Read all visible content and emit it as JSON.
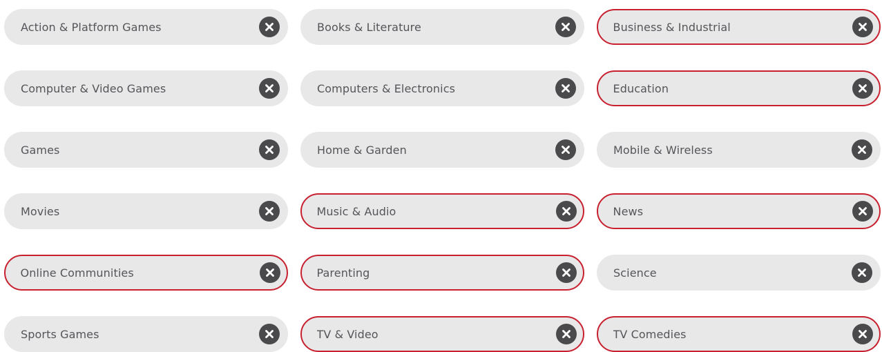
{
  "colors": {
    "chip_background": "#e8e8e9",
    "selected_border": "#c8202e",
    "label_text": "#555559",
    "remove_button": "#4a4a4d"
  },
  "remove_icon": "close-icon",
  "categories": [
    {
      "label": "Action & Platform Games",
      "selected": false
    },
    {
      "label": "Books & Literature",
      "selected": false
    },
    {
      "label": "Business & Industrial",
      "selected": true
    },
    {
      "label": "Computer & Video Games",
      "selected": false
    },
    {
      "label": "Computers & Electronics",
      "selected": false
    },
    {
      "label": "Education",
      "selected": true
    },
    {
      "label": "Games",
      "selected": false
    },
    {
      "label": "Home & Garden",
      "selected": false
    },
    {
      "label": "Mobile & Wireless",
      "selected": false
    },
    {
      "label": "Movies",
      "selected": false
    },
    {
      "label": "Music & Audio",
      "selected": true
    },
    {
      "label": "News",
      "selected": true
    },
    {
      "label": "Online Communities",
      "selected": true
    },
    {
      "label": "Parenting",
      "selected": true
    },
    {
      "label": "Science",
      "selected": false
    },
    {
      "label": "Sports Games",
      "selected": false
    },
    {
      "label": "TV & Video",
      "selected": true
    },
    {
      "label": "TV Comedies",
      "selected": true
    }
  ]
}
